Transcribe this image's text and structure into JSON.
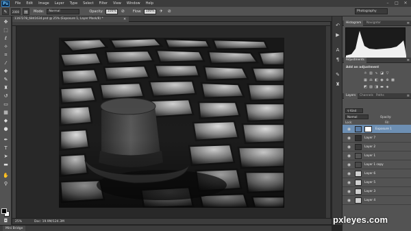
{
  "app": {
    "logo": "Ps"
  },
  "menu": {
    "items": [
      "File",
      "Edit",
      "Image",
      "Layer",
      "Type",
      "Select",
      "Filter",
      "View",
      "Window",
      "Help"
    ]
  },
  "window_controls": {
    "minimize": "–",
    "maximize": "□",
    "close": "✕"
  },
  "options_bar": {
    "mode_label": "Mode:",
    "mode_value": "Normal",
    "opacity_label": "Opacity:",
    "opacity_value": "100%",
    "flow_label": "Flow:",
    "flow_value": "100%",
    "brush_size": "2000",
    "workspace": "Photography"
  },
  "document": {
    "tab_title": "1167278_6841634.psd @ 25% (Exposure 1, Layer Mask/8) *",
    "close_glyph": "×",
    "zoom": "25%",
    "doc_size": "Doc: 19.9M/124.3M"
  },
  "mini_bridge": {
    "label": "Mini Bridge"
  },
  "panels": {
    "top_tabs": [
      "Histogram",
      "Navigator"
    ],
    "adjustments_tab": "Adjustments",
    "adjustments_title": "Add an adjustment",
    "layers_tabs": [
      "Layers",
      "Channels",
      "Paths"
    ],
    "kind_label": "Kind",
    "blend_mode": "Normal",
    "opacity_label": "Opacity:",
    "lock_label": "Lock:",
    "fill_label": "Fill:"
  },
  "layers": [
    {
      "name": "Exposure 1",
      "selected": true,
      "thumb": "#c8c8c8"
    },
    {
      "name": "Layer 7",
      "selected": false,
      "thumb": "#2e2e2e"
    },
    {
      "name": "Layer 2",
      "selected": false,
      "thumb": "#3a3a3a"
    },
    {
      "name": "Layer 1",
      "selected": false,
      "thumb": "#555555"
    },
    {
      "name": "Layer 1 copy",
      "selected": false,
      "thumb": "#4a4a4a"
    },
    {
      "name": "Layer 6",
      "selected": false,
      "thumb": "#d0d0d0"
    },
    {
      "name": "Layer 5",
      "selected": false,
      "thumb": "#d0d0d0"
    },
    {
      "name": "Layer 3",
      "selected": false,
      "thumb": "#cfcfcf"
    },
    {
      "name": "Layer 4",
      "selected": false,
      "thumb": "#cfcfcf"
    }
  ],
  "watermark": {
    "text": "pxleyes.com"
  }
}
